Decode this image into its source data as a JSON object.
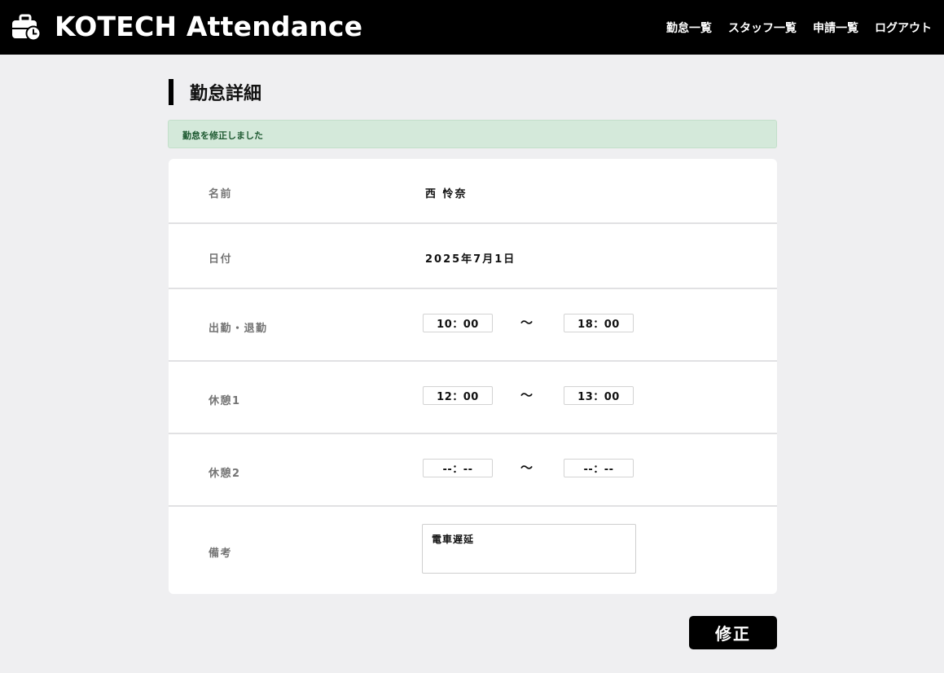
{
  "header": {
    "app_title": "KOTECH Attendance",
    "logo_icon": "briefcase-clock-icon",
    "nav": [
      {
        "label": "勤怠一覧"
      },
      {
        "label": "スタッフ一覧"
      },
      {
        "label": "申請一覧"
      },
      {
        "label": "ログアウト"
      }
    ]
  },
  "page": {
    "title": "勤怠詳細",
    "flash_message": "勤怠を修正しました"
  },
  "form": {
    "name": {
      "label": "名前",
      "value": "西 怜奈"
    },
    "date": {
      "label": "日付",
      "value": "2025年7月1日"
    },
    "work": {
      "label": "出勤・退勤",
      "start": "10：00",
      "end": "18：00"
    },
    "break1": {
      "label": "休憩1",
      "start": "12：00",
      "end": "13：00"
    },
    "break2": {
      "label": "休憩2",
      "start": "--：--",
      "end": "--：--"
    },
    "note": {
      "label": "備考",
      "value": "電車遅延"
    },
    "range_separator": "～",
    "submit_label": "修正"
  },
  "colors": {
    "header_bg": "#000000",
    "page_bg": "#efeff1",
    "flash_bg": "#d4e9da",
    "flash_text": "#1e5a31",
    "button_bg": "#000000"
  }
}
